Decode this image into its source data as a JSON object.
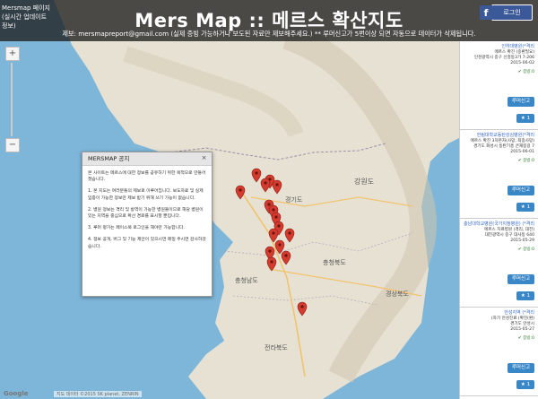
{
  "header": {
    "fb_page_label": "Mersmap 페이지",
    "fb_page_sub1": "(실시간 업데이트",
    "fb_page_sub2": "정보)",
    "title": "Mers Map :: 메르스 확산지도",
    "notice": "제보: mersmapreport@gmail.com (실제 증빙 가능하거나 보도된 자료만 제보해주세요.) ** 루머신고가 5번이상 되면 자동으로 데이터가 삭제됩니다.",
    "login_label": "로그인"
  },
  "zoom": {
    "in": "+",
    "out": "−"
  },
  "dialog": {
    "title": "MERSMAP 공지",
    "close": "×",
    "paragraphs": [
      "본 사이트는 메르스에 대한 정보를 공유하기 위한 목적으로 만들어졌습니다.",
      "1. 본 지도는 여러분들의 제보로 이루어집니다. 보도자료 및 실제 입증이 가능한 정보만 제보 받기 위해 쓰기 가능이 없습니다.",
      "2. 병원 정보는 격리 및 방역이 가능한 병원들이므로 해당 병원이 있는 지역을 중심으로 확산 경로를 표시할 뿐입니다.",
      "3. 루머 평가는 페이스북 로그인을 해야만 가능합니다.",
      "4. 정보 공개, 버그 및 기능 제안이 있으시면 메일 주시면 감사하겠습니다."
    ]
  },
  "sidebar": {
    "cards": [
      {
        "name": "인하대병원(*격리",
        "status": "메르스 확진 (중환필요)",
        "address": "인천광역시 중구 신흥동3가 7-206",
        "date": "2015-06-02",
        "meta": "✔ 증빙:0",
        "report": "루머신고",
        "likes": "1"
      },
      {
        "name": "한림대학교동탄성심병원(*격리",
        "status": "메르스 확진 3차본자(사망, 최종사망)",
        "address": "경기도 화성시 동탄기흥 큰재봉길 7",
        "date": "2015-06-01",
        "meta": "✔ 증빙:0",
        "report": "루머신고",
        "likes": "1"
      },
      {
        "name": "충남대학교병원(국가지정병원) (*격리",
        "status": "메르스 치료병원 (격리, 대전)",
        "address": "대전광역시 중구 대사동 640",
        "date": "2015-05-29",
        "meta": "✔ 증빙:0",
        "report": "루머신고",
        "likes": "1"
      },
      {
        "name": "안성지역 (*격리",
        "status": "(자가 안성진료 (확진(환)",
        "address": "경기도 안성시",
        "date": "2015-05-27",
        "meta": "✔ 증빙:0",
        "report": "루머신고",
        "likes": "1"
      }
    ]
  },
  "map": {
    "places": [
      {
        "label": "강원도"
      },
      {
        "label": "경기도"
      },
      {
        "label": "충청북도"
      },
      {
        "label": "충청남도"
      },
      {
        "label": "전라북도"
      },
      {
        "label": "경상북도"
      }
    ],
    "markers_count": 16
  },
  "footer": {
    "google": "Google",
    "attribution": "지도 데이터 ©2015 SK planet, ZENRIN"
  },
  "colors": {
    "sea": "#7eb6d9",
    "land": "#e8e4d9",
    "marker": "#d33b2e",
    "button": "#3a87c8"
  }
}
